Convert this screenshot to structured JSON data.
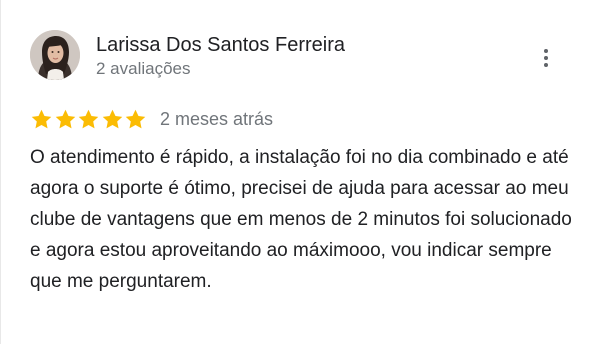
{
  "review": {
    "reviewer_name": "Larissa Dos Santos Ferreira",
    "review_count": "2 avaliações",
    "rating": 5,
    "max_rating": 5,
    "date": "2 meses atrás",
    "text": "O atendimento é rápido, a instalação foi no dia combinado e até agora o suporte é ótimo, precisei de ajuda para acessar ao meu clube de vantagens que em menos de 2 minutos foi solucionado e agora estou aproveitando ao máximooo, vou indicar sempre que me perguntarem."
  },
  "icons": {
    "avatar": "profile-photo",
    "more": "more-vert-icon",
    "star": "star-icon"
  },
  "colors": {
    "star": "#fbbc04",
    "name": "#202124",
    "secondary": "#70757a",
    "text": "#202124"
  }
}
